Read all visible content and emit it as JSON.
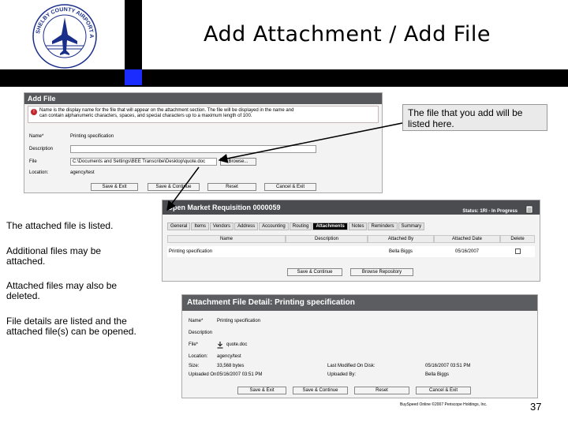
{
  "slide": {
    "title": "Add Attachment / Add File",
    "page_number": "37",
    "footer": "BuySpeed Online ©2007 Periscope Holdings, Inc.",
    "logo_text": "SHELBY COUNTY AIRPORT AUTHORITY"
  },
  "captions": {
    "callout": "The file that you add will be listed here.",
    "listed": "The attached file is listed.",
    "additional": "Additional files may be attached.",
    "deleted": "Attached files may also be deleted.",
    "details": "File details are listed and the attached file(s) can be opened."
  },
  "add_file": {
    "title": "Add File",
    "note_line1": "Name is the display name for the file that will appear on the attachment section. The file will be displayed in the name and",
    "note_line2": "can contain alphanumeric characters, spaces, and special characters up to a maximum length of 100.",
    "fields": {
      "name_label": "Name*",
      "name_value": "Printing specification",
      "description_label": "Description",
      "file_label": "File",
      "file_value": "C:\\Documents and Settings\\BEE Transcribe\\Desktop\\quote.doc",
      "browse_label": "Browse...",
      "location_label": "Location:",
      "location_value": "agency/test"
    },
    "buttons": {
      "save_exit": "Save & Exit",
      "save_continue": "Save & Continue",
      "reset": "Reset",
      "cancel_exit": "Cancel & Exit"
    }
  },
  "requisition": {
    "title": "Open Market Requisition 0000059",
    "status": "Status: 1RI - In Progress",
    "tabs": [
      "General",
      "Items",
      "Vendors",
      "Address",
      "Accounting",
      "Routing",
      "Attachments",
      "Notes",
      "Reminders",
      "Summary"
    ],
    "active_tab": "Attachments",
    "columns": [
      "Name",
      "Description",
      "Attached By",
      "Attached Date",
      "Delete"
    ],
    "row": {
      "name": "Printing specification",
      "description": "",
      "attached_by": "Bella Biggs",
      "attached_date": "05/16/2007"
    },
    "buttons": {
      "save_continue": "Save & Continue",
      "browse_repository": "Browse Repository"
    }
  },
  "detail": {
    "title": "Attachment File Detail: Printing specification",
    "rows": {
      "name_label": "Name*",
      "name_value": "Printing specification",
      "description_label": "Description",
      "file_label": "File*",
      "file_value": "quote.doc",
      "location_label": "Location:",
      "location_value": "agency/test",
      "size_label": "Size:",
      "size_value": "33,568 bytes",
      "uploaded_on_label": "Uploaded On:",
      "uploaded_on_value": "05/16/2007 03:51 PM",
      "modified_label": "Last Modified On Disk:",
      "modified_value": "05/16/2007 03:51 PM",
      "uploaded_by_label": "Uploaded By:",
      "uploaded_by_value": "Bella Biggs"
    },
    "buttons": {
      "save_exit": "Save & Exit",
      "save_continue": "Save & Continue",
      "reset": "Reset",
      "cancel_exit": "Cancel & Exit"
    }
  },
  "colors": {
    "frame": "#000000",
    "accent_square": "#1a2cff",
    "panel_header": "#56585c",
    "callout_bg": "#eaeaea"
  }
}
